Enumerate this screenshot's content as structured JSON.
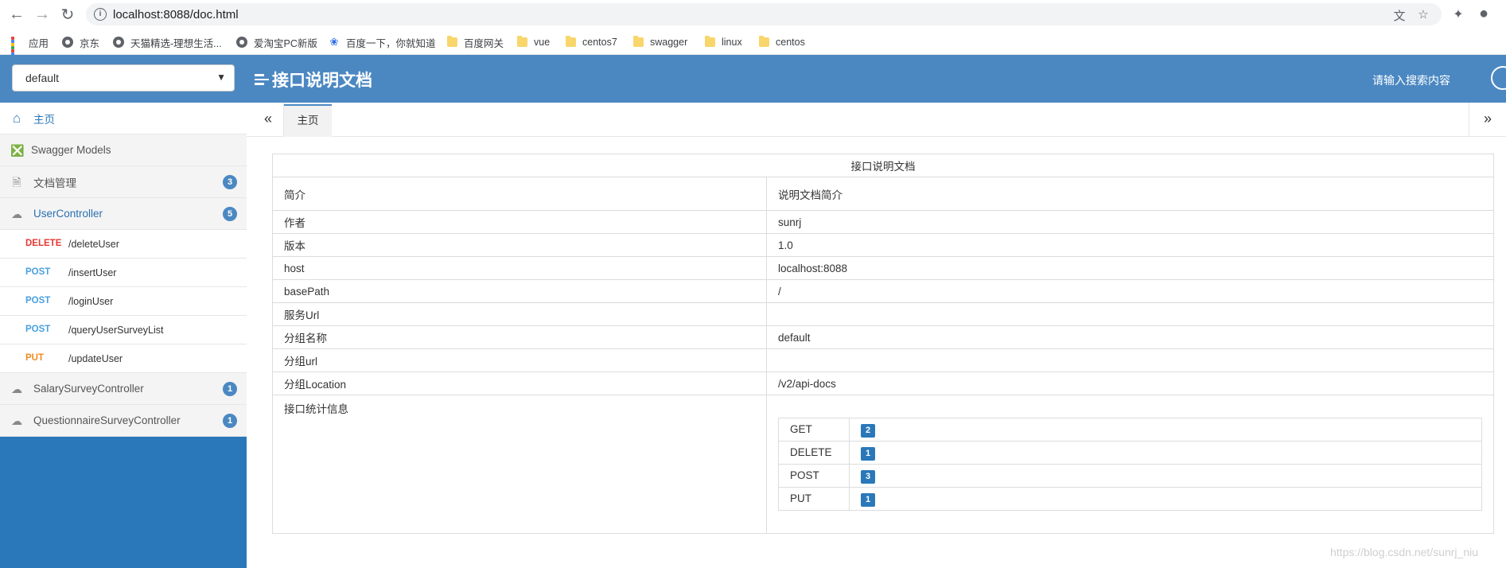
{
  "browser": {
    "url": "localhost:8088/doc.html",
    "bookmarks": [
      {
        "label": "应用",
        "icon": "apps-grid-icon"
      },
      {
        "label": "京东",
        "icon": "globe-icon"
      },
      {
        "label": "天猫精选-理想生活...",
        "icon": "globe-icon"
      },
      {
        "label": "爱淘宝PC新版",
        "icon": "globe-icon"
      },
      {
        "label": "百度一下，你就知道",
        "icon": "baidu-paw-icon"
      },
      {
        "label": "百度网关",
        "icon": "folder-icon"
      },
      {
        "label": "vue",
        "icon": "folder-icon"
      },
      {
        "label": "centos7",
        "icon": "folder-icon"
      },
      {
        "label": "swagger",
        "icon": "folder-icon"
      },
      {
        "label": "linux",
        "icon": "folder-icon"
      },
      {
        "label": "centos",
        "icon": "folder-icon"
      }
    ]
  },
  "header": {
    "group_select": "default",
    "title": "接口说明文档",
    "search_label": "请输入搜索内容",
    "color": "#4b88c2"
  },
  "sidebar": {
    "home": "主页",
    "models": "Swagger Models",
    "docs": {
      "label": "文档管理",
      "count": "3"
    },
    "controllers": [
      {
        "label": "UserController",
        "count": "5"
      },
      {
        "label": "SalarySurveyController",
        "count": "1"
      },
      {
        "label": "QuestionnaireSurveyController",
        "count": "1"
      }
    ],
    "apis": [
      {
        "method": "DELETE",
        "path": "/deleteUser"
      },
      {
        "method": "POST",
        "path": "/insertUser"
      },
      {
        "method": "POST",
        "path": "/loginUser"
      },
      {
        "method": "POST",
        "path": "/queryUserSurveyList"
      },
      {
        "method": "PUT",
        "path": "/updateUser"
      }
    ]
  },
  "tabs": {
    "home": "主页"
  },
  "doc": {
    "title": "接口说明文档",
    "rows": [
      {
        "key": "简介",
        "value": "说明文档简介"
      },
      {
        "key": "作者",
        "value": "sunrj"
      },
      {
        "key": "版本",
        "value": "1.0"
      },
      {
        "key": "host",
        "value": "localhost:8088"
      },
      {
        "key": "basePath",
        "value": "/"
      },
      {
        "key": "服务Url",
        "value": ""
      },
      {
        "key": "分组名称",
        "value": "default"
      },
      {
        "key": "分组url",
        "value": ""
      },
      {
        "key": "分组Location",
        "value": "/v2/api-docs"
      }
    ],
    "stats_label": "接口统计信息",
    "stats": [
      {
        "method": "GET",
        "count": "2"
      },
      {
        "method": "DELETE",
        "count": "1"
      },
      {
        "method": "POST",
        "count": "3"
      },
      {
        "method": "PUT",
        "count": "1"
      }
    ]
  },
  "watermark": "https://blog.csdn.net/sunrj_niu"
}
